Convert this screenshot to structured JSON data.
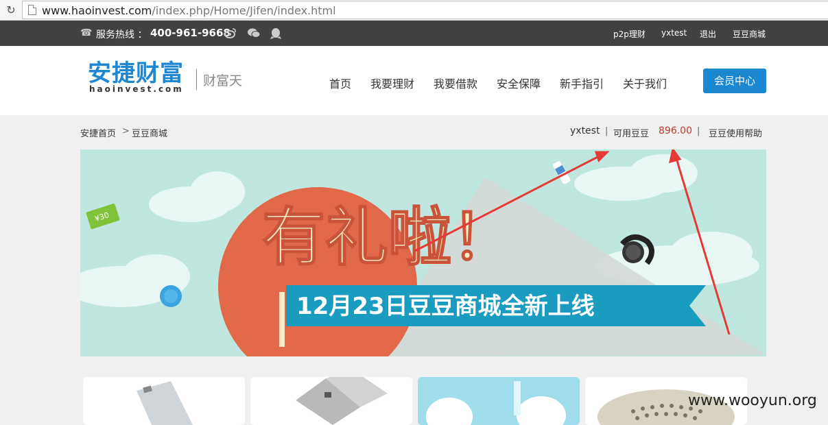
{
  "browser": {
    "url_host": "www.haoinvest.com",
    "url_path": "/index.php/Home/Jifen/index.html"
  },
  "topbar": {
    "hotline_label": "服务热线 ：",
    "hotline_number": "400-961-9668",
    "links": [
      "p2p理财",
      "yxtest",
      "退出",
      "豆豆商城"
    ]
  },
  "header": {
    "logo_cn": "安捷财富",
    "logo_en": "haoinvest.com",
    "logo_sub": "财富天",
    "nav": [
      "首页",
      "我要理财",
      "我要借款",
      "安全保障",
      "新手指引",
      "关于我们"
    ],
    "member_button": "会员中心"
  },
  "crumbs": {
    "home": "安捷首页",
    "arrow": ">",
    "current": "豆豆商城",
    "user": "yxtest",
    "available_label": "可用豆豆",
    "available_value": "896.00",
    "help": "豆豆使用帮助",
    "divider": "|"
  },
  "banner": {
    "headline": "有礼啦！",
    "ribbon": "12月23日豆豆商城全新上线",
    "coupon": "¥30"
  },
  "watermark": "www.wooyun.org",
  "colors": {
    "brand_blue": "#1a87d0",
    "topbar_bg": "#414141",
    "bean_red": "#c0392b",
    "banner_circle": "#e2684a",
    "ribbon": "#1a9cc0",
    "arrow": "#e53935"
  }
}
